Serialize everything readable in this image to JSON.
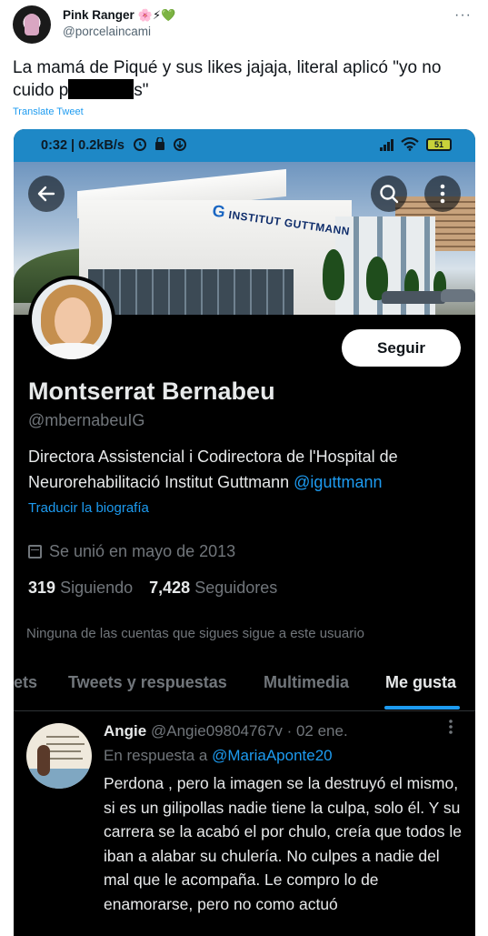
{
  "outer_tweet": {
    "author_name": "Pink Ranger",
    "author_emojis": "🌸⚡💚",
    "author_handle": "@porcelaincami",
    "more_glyph": "···",
    "text_before_redaction": "La mamá de Piqué y sus likes jajaja, literal aplicó \"yo no cuido p",
    "text_after_redaction": "s\"",
    "translate_label": "Translate Tweet"
  },
  "status_bar": {
    "time_and_speed": "0:32 | 0.2kB/s",
    "battery": "51",
    "signal_bars": 4
  },
  "profile": {
    "follow_button_label": "Seguir",
    "display_name": "Montserrat Bernabeu",
    "handle": "@mbernabeuIG",
    "bio_text": "Directora Assistencial i Codirectora de l'Hospital de Neurorehabilitació Institut Guttmann ",
    "bio_mention": "@iguttmann",
    "translate_bio_label": "Traducir la biografía",
    "joined_text": "Se unió en mayo de 2013",
    "following_count": "319",
    "following_label": "Siguiendo",
    "followers_count": "7,428",
    "followers_label": "Seguidores",
    "no_followers_known": "Ninguna de las cuentas que sigues sigue a este usuario",
    "banner_sign": "INSTITUT GUTTMANN"
  },
  "tabs": [
    {
      "label": "ets",
      "active": false
    },
    {
      "label": "Tweets y respuestas",
      "active": false
    },
    {
      "label": "Multimedia",
      "active": false
    },
    {
      "label": "Me gusta",
      "active": true
    }
  ],
  "reply_tweet": {
    "author_name": "Angie",
    "author_handle": "@Angie09804767v",
    "date": "· 02 ene.",
    "reply_prefix": "En respuesta a ",
    "reply_mention": "@MariaAponte20",
    "text": "Perdona , pero la imagen se la destruyó el mismo, si es un gilipollas nadie tiene la culpa, solo él. Y su carrera se la acabó el por chulo, creía que todos le iban a alabar su chulería. No culpes a nadie del mal que le acompaña. Le compro lo de enamorarse, pero no como actuó"
  },
  "colors": {
    "accent": "#1d9bf0",
    "status_bar": "#1e88c6",
    "dark_background": "#000000"
  }
}
